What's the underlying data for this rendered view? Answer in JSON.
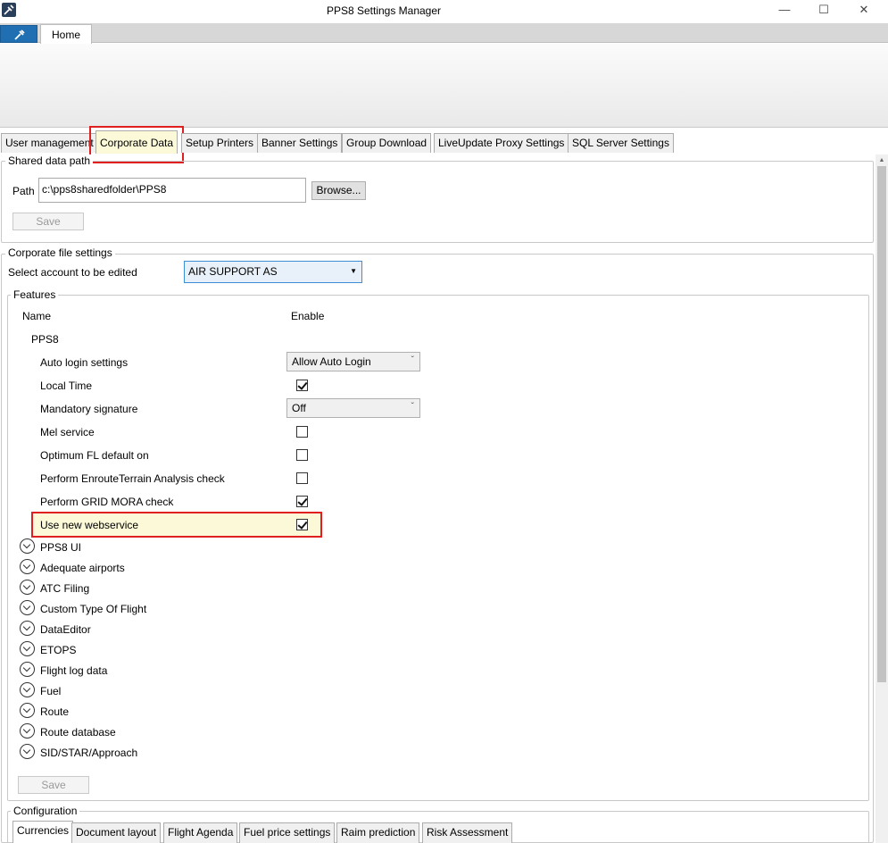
{
  "window": {
    "title": "PPS8 Settings Manager",
    "minimize": "—",
    "maximize": "☐",
    "close": "✕"
  },
  "ribbon": {
    "home_tab": "Home"
  },
  "tabs": [
    {
      "label": "User management"
    },
    {
      "label": "Corporate Data"
    },
    {
      "label": "Setup Printers"
    },
    {
      "label": "Banner Settings"
    },
    {
      "label": "Group Download"
    },
    {
      "label": "LiveUpdate Proxy Settings"
    },
    {
      "label": "SQL Server Settings"
    }
  ],
  "shared_data": {
    "legend": "Shared data path",
    "path_label": "Path",
    "path_value": "c:\\pps8sharedfolder\\PPS8",
    "browse": "Browse...",
    "save": "Save"
  },
  "corporate": {
    "legend": "Corporate file settings",
    "account_label": "Select account to be edited",
    "account_value": "AIR SUPPORT AS"
  },
  "features": {
    "legend": "Features",
    "col_name": "Name",
    "col_enable": "Enable",
    "group": "PPS8",
    "items": [
      {
        "label": "Auto login settings",
        "type": "combo",
        "value": "Allow Auto Login"
      },
      {
        "label": "Local Time",
        "type": "check",
        "checked": true
      },
      {
        "label": "Mandatory signature",
        "type": "combo",
        "value": "Off"
      },
      {
        "label": "Mel service",
        "type": "check",
        "checked": false
      },
      {
        "label": "Optimum FL default on",
        "type": "check",
        "checked": false
      },
      {
        "label": "Perform EnrouteTerrain Analysis check",
        "type": "check",
        "checked": false
      },
      {
        "label": "Perform GRID MORA check",
        "type": "check",
        "checked": true
      },
      {
        "label": "Use new webservice",
        "type": "check",
        "checked": true
      }
    ],
    "groups": [
      "PPS8 UI",
      "Adequate airports",
      "ATC Filing",
      "Custom Type Of Flight",
      "DataEditor",
      "ETOPS",
      "Flight log data",
      "Fuel",
      "Route",
      "Route database",
      "SID/STAR/Approach"
    ],
    "save": "Save"
  },
  "configuration": {
    "legend": "Configuration",
    "tabs": [
      "Currencies",
      "Document layout",
      "Flight Agenda",
      "Fuel price settings",
      "Raim prediction",
      "Risk Assessment"
    ]
  }
}
